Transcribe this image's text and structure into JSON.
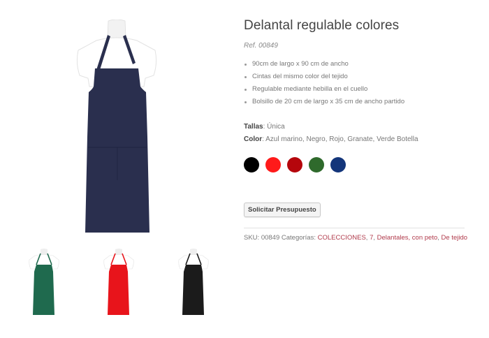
{
  "product": {
    "title": "Delantal regulable colores",
    "ref": "Ref. 00849",
    "features": [
      "90cm de largo x 90 cm de ancho",
      "Cintas del mismo color del tejido",
      "Regulable mediante hebilla en el cuello",
      "Bolsillo de 20 cm de largo x 35 cm de ancho partido"
    ],
    "tallas_label": "Tallas",
    "tallas_value": ": Única",
    "color_label": "Color",
    "color_value": ": Azul marino, Negro, Rojo, Granate, Verde Botella",
    "swatches": [
      "#000000",
      "#ff1a1a",
      "#b5060c",
      "#2f6a2c",
      "#13357a"
    ],
    "quote_button": "Solicitar Presupuesto",
    "meta": {
      "sku_label": "SKU: ",
      "sku": "00849",
      "categories_label": " Categorías: ",
      "categories": [
        "COLECCIONES",
        "7",
        "Delantales, con peto",
        "De tejido"
      ]
    }
  },
  "gallery": {
    "main_color": "#2a2f4e",
    "thumbnails": [
      {
        "name": "green",
        "color": "#1f6a4e"
      },
      {
        "name": "red",
        "color": "#e8141b"
      },
      {
        "name": "black",
        "color": "#1b1b1b"
      }
    ]
  }
}
